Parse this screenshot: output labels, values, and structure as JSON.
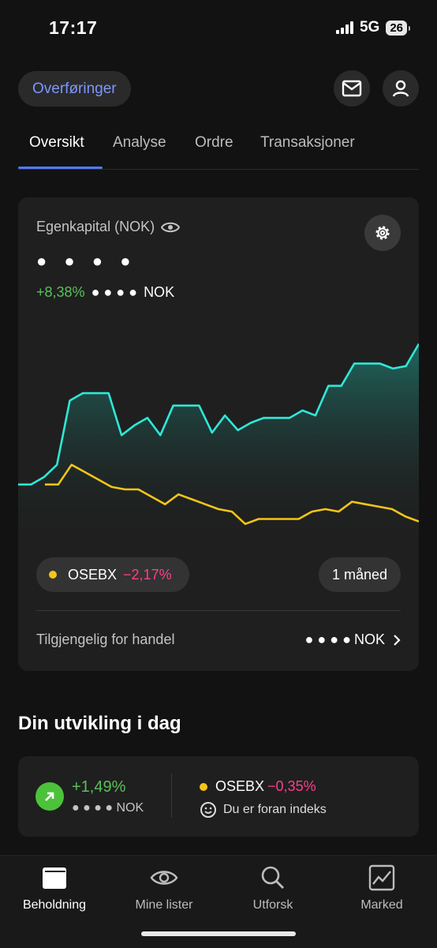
{
  "status": {
    "time": "17:17",
    "network": "5G",
    "battery": "26"
  },
  "header": {
    "transfer_label": "Overføringer",
    "mail_icon": "mail-icon",
    "profile_icon": "person-icon"
  },
  "tabs": [
    {
      "label": "Oversikt",
      "active": true
    },
    {
      "label": "Analyse",
      "active": false
    },
    {
      "label": "Ordre",
      "active": false
    },
    {
      "label": "Transaksjoner",
      "active": false
    }
  ],
  "equity": {
    "label": "Egenkapital (NOK)",
    "hidden_value": "● ● ● ●",
    "change_pct": "+8,38%",
    "change_hidden": "● ● ● ●",
    "change_currency": "NOK",
    "settings_icon": "gear-icon",
    "eye_icon": "eye-icon"
  },
  "chart_data": {
    "type": "line",
    "series": [
      {
        "name": "",
        "color": "#2ee8d8",
        "values": [
          18,
          18,
          21,
          26,
          52,
          55,
          55,
          55,
          38,
          42,
          45,
          38,
          50,
          50,
          50,
          39,
          46,
          40,
          43,
          45,
          45,
          45,
          48,
          46,
          58,
          58,
          67,
          67,
          67,
          65,
          66,
          75
        ]
      },
      {
        "name": "OSEBX",
        "color": "#f3c518",
        "values": [
          null,
          null,
          18,
          18,
          26,
          23,
          20,
          17,
          16,
          16,
          13,
          10,
          14,
          12,
          10,
          8,
          7,
          2,
          4,
          4,
          4,
          4,
          7,
          8,
          7,
          11,
          10,
          9,
          8,
          5,
          3
        ]
      }
    ],
    "ylim": [
      0,
      80
    ]
  },
  "benchmark": {
    "name": "OSEBX",
    "change": "−2,17%"
  },
  "period": "1 måned",
  "available": {
    "label": "Tilgjengelig for handel",
    "hidden": "● ● ● ●",
    "currency": "NOK"
  },
  "today": {
    "title": "Din utvikling i dag",
    "pct": "+1,49%",
    "nok_hidden": "● ● ● ●",
    "nok": "NOK",
    "index_name": "OSEBX",
    "index_change": "−0,35%",
    "message": "Du er foran indeks"
  },
  "nav": [
    {
      "label": "Beholdning",
      "icon": "wallet-icon",
      "active": true
    },
    {
      "label": "Mine lister",
      "icon": "eye-icon",
      "active": false
    },
    {
      "label": "Utforsk",
      "icon": "search-icon",
      "active": false
    },
    {
      "label": "Marked",
      "icon": "chart-icon",
      "active": false
    }
  ]
}
